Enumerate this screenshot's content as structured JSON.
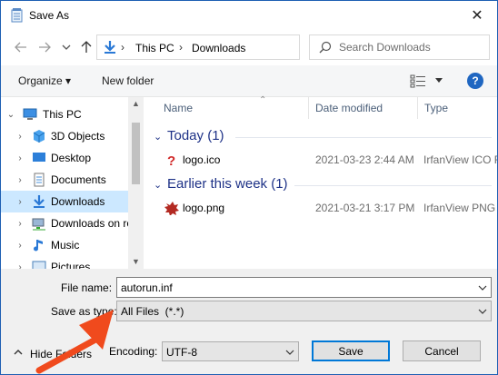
{
  "window": {
    "title": "Save As",
    "close_glyph": "✕"
  },
  "address_bar": {
    "crumbs": [
      "This PC",
      "Downloads"
    ],
    "separator": "›",
    "dropdown_glyph": "⌄",
    "refresh_glyph": "↻",
    "search_placeholder": "Search Downloads"
  },
  "toolbar": {
    "organize_label": "Organize ▾",
    "new_folder_label": "New folder",
    "help_label": "?"
  },
  "navigation": {
    "items": [
      {
        "label": "This PC",
        "icon": "pc-icon",
        "expanded": true
      },
      {
        "label": "3D Objects",
        "icon": "3d-objects-icon"
      },
      {
        "label": "Desktop",
        "icon": "desktop-icon"
      },
      {
        "label": "Documents",
        "icon": "documents-icon"
      },
      {
        "label": "Downloads",
        "icon": "downloads-icon",
        "selected": true
      },
      {
        "label": "Downloads on ro",
        "icon": "network-folder-icon"
      },
      {
        "label": "Music",
        "icon": "music-icon"
      },
      {
        "label": "Pictures",
        "icon": "pictures-icon"
      }
    ]
  },
  "file_list": {
    "columns": [
      "Name",
      "Date modified",
      "Type"
    ],
    "groups": [
      {
        "title": "Today (1)",
        "files": [
          {
            "name": "logo.ico",
            "date": "2021-03-23 2:44 AM",
            "type": "IrfanView ICO F",
            "icon": "question-file-icon"
          }
        ]
      },
      {
        "title": "Earlier this week (1)",
        "files": [
          {
            "name": "logo.png",
            "date": "2021-03-21 3:17 PM",
            "type": "IrfanView PNG",
            "icon": "png-file-icon"
          }
        ]
      }
    ]
  },
  "form": {
    "filename_label": "File name:",
    "filename_value": "autorun.inf",
    "type_label": "Save as type:",
    "type_value": "All Files  (*.*)",
    "encoding_label": "Encoding:",
    "encoding_value": "UTF-8",
    "save_label": "Save",
    "cancel_label": "Cancel",
    "hide_folders_label": "Hide Folders"
  },
  "colors": {
    "accent": "#0078d7",
    "selection": "#cce8ff",
    "group_title": "#1e3287",
    "annotation_arrow": "#f04a1d"
  }
}
